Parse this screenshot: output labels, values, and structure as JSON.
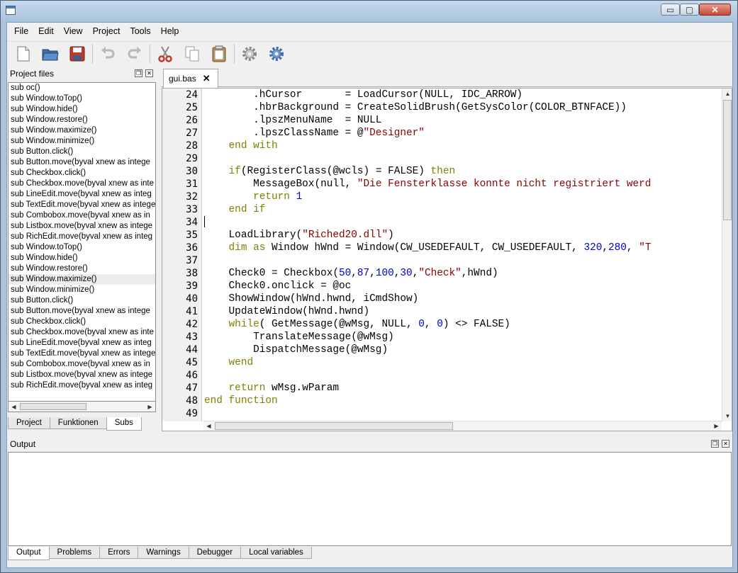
{
  "menu": [
    "File",
    "Edit",
    "View",
    "Project",
    "Tools",
    "Help"
  ],
  "toolbar": [
    {
      "name": "new-file-icon"
    },
    {
      "name": "open-folder-icon"
    },
    {
      "name": "save-icon"
    },
    {
      "name": "undo-icon"
    },
    {
      "name": "redo-icon"
    },
    {
      "name": "cut-icon"
    },
    {
      "name": "copy-icon"
    },
    {
      "name": "paste-icon"
    },
    {
      "name": "build-settings-icon"
    },
    {
      "name": "run-icon"
    }
  ],
  "window_buttons": {
    "minimize": "▭",
    "maximize": "▢",
    "close": "✕"
  },
  "left_panel": {
    "title": "Project files",
    "items": [
      "sub oc()",
      "sub Window.toTop()",
      "sub Window.hide()",
      "sub Window.restore()",
      "sub Window.maximize()",
      "sub Window.minimize()",
      "sub Button.click()",
      "sub Button.move(byval xnew as intege",
      "sub Checkbox.click()",
      "sub Checkbox.move(byval xnew as inte",
      "sub LineEdit.move(byval xnew as integ",
      "sub TextEdit.move(byval xnew as intege",
      "sub Combobox.move(byval xnew as in",
      "sub Listbox.move(byval xnew as intege",
      "sub RichEdit.move(byval xnew as integ",
      "sub Window.toTop()",
      "sub Window.hide()",
      "sub Window.restore()",
      "sub Window.maximize()",
      "sub Window.minimize()",
      "sub Button.click()",
      "sub Button.move(byval xnew as intege",
      "sub Checkbox.click()",
      "sub Checkbox.move(byval xnew as inte",
      "sub LineEdit.move(byval xnew as integ",
      "sub TextEdit.move(byval xnew as intege",
      "sub Combobox.move(byval xnew as in",
      "sub Listbox.move(byval xnew as intege",
      "sub RichEdit.move(byval xnew as integ"
    ],
    "selected_index": 18,
    "tabs": [
      "Project",
      "Funktionen",
      "Subs"
    ],
    "active_tab": 2
  },
  "editor": {
    "tab_label": "gui.bas",
    "lines": [
      {
        "n": "24",
        "segs": [
          [
            "        .hCursor       = LoadCursor(NULL, IDC_ARROW)",
            ""
          ]
        ]
      },
      {
        "n": "25",
        "segs": [
          [
            "        .hbrBackground = CreateSolidBrush(GetSysColor(COLOR_BTNFACE))",
            ""
          ]
        ]
      },
      {
        "n": "26",
        "segs": [
          [
            "        .lpszMenuName  = NULL",
            ""
          ]
        ]
      },
      {
        "n": "27",
        "segs": [
          [
            "        .lpszClassName = @",
            ""
          ],
          [
            "\"Designer\"",
            "str"
          ]
        ]
      },
      {
        "n": "28",
        "segs": [
          [
            "    ",
            ""
          ],
          [
            "end with",
            "kw"
          ]
        ]
      },
      {
        "n": "29",
        "segs": [
          [
            "",
            ""
          ]
        ]
      },
      {
        "n": "30",
        "segs": [
          [
            "    ",
            ""
          ],
          [
            "if",
            "kw"
          ],
          [
            "(RegisterClass(@wcls) = FALSE) ",
            ""
          ],
          [
            "then",
            "kw"
          ]
        ]
      },
      {
        "n": "31",
        "segs": [
          [
            "        MessageBox(null, ",
            ""
          ],
          [
            "\"Die Fensterklasse konnte nicht registriert werd",
            "str"
          ]
        ]
      },
      {
        "n": "32",
        "segs": [
          [
            "        ",
            ""
          ],
          [
            "return",
            "kw"
          ],
          [
            " ",
            ""
          ],
          [
            "1",
            "num"
          ]
        ]
      },
      {
        "n": "33",
        "segs": [
          [
            "    ",
            ""
          ],
          [
            "end if",
            "kw"
          ]
        ]
      },
      {
        "n": "34",
        "segs": [
          [
            "",
            ""
          ]
        ]
      },
      {
        "n": "35",
        "segs": [
          [
            "    LoadLibrary(",
            ""
          ],
          [
            "\"Riched20.dll\"",
            "str"
          ],
          [
            ")",
            ""
          ]
        ]
      },
      {
        "n": "36",
        "segs": [
          [
            "    ",
            ""
          ],
          [
            "dim as",
            "kw"
          ],
          [
            " Window hWnd = Window(CW_USEDEFAULT, CW_USEDEFAULT, ",
            ""
          ],
          [
            "320",
            "num"
          ],
          [
            ",",
            ""
          ],
          [
            "280",
            "num"
          ],
          [
            ", ",
            ""
          ],
          [
            "\"T",
            "str"
          ]
        ]
      },
      {
        "n": "37",
        "segs": [
          [
            "",
            ""
          ]
        ]
      },
      {
        "n": "38",
        "segs": [
          [
            "    Check0 = Checkbox(",
            ""
          ],
          [
            "50",
            "num"
          ],
          [
            ",",
            ""
          ],
          [
            "87",
            "num"
          ],
          [
            ",",
            ""
          ],
          [
            "100",
            "num"
          ],
          [
            ",",
            ""
          ],
          [
            "30",
            "num"
          ],
          [
            ",",
            ""
          ],
          [
            "\"Check\"",
            "str"
          ],
          [
            ",hWnd)",
            ""
          ]
        ]
      },
      {
        "n": "39",
        "segs": [
          [
            "    Check0.onclick = @oc",
            ""
          ]
        ]
      },
      {
        "n": "40",
        "segs": [
          [
            "    ShowWindow(hWnd.hwnd, iCmdShow)",
            ""
          ]
        ]
      },
      {
        "n": "41",
        "segs": [
          [
            "    UpdateWindow(hWnd.hwnd)",
            ""
          ]
        ]
      },
      {
        "n": "42",
        "segs": [
          [
            "    ",
            ""
          ],
          [
            "while",
            "kw"
          ],
          [
            "( GetMessage(@wMsg, NULL, ",
            ""
          ],
          [
            "0",
            "num"
          ],
          [
            ", ",
            ""
          ],
          [
            "0",
            "num"
          ],
          [
            ") <> FALSE)",
            ""
          ]
        ]
      },
      {
        "n": "43",
        "segs": [
          [
            "        TranslateMessage(@wMsg)",
            ""
          ]
        ]
      },
      {
        "n": "44",
        "segs": [
          [
            "        DispatchMessage(@wMsg)",
            ""
          ]
        ]
      },
      {
        "n": "45",
        "segs": [
          [
            "    ",
            ""
          ],
          [
            "wend",
            "kw"
          ]
        ]
      },
      {
        "n": "46",
        "segs": [
          [
            "",
            ""
          ]
        ]
      },
      {
        "n": "47",
        "segs": [
          [
            "    ",
            ""
          ],
          [
            "return",
            "kw"
          ],
          [
            " wMsg.wParam",
            ""
          ]
        ]
      },
      {
        "n": "48",
        "segs": [
          [
            "end function",
            "kw"
          ]
        ]
      },
      {
        "n": "49",
        "segs": [
          [
            "",
            ""
          ]
        ]
      }
    ]
  },
  "output_panel": {
    "title": "Output",
    "tabs": [
      "Output",
      "Problems",
      "Errors",
      "Warnings",
      "Debugger",
      "Local variables"
    ],
    "active_tab": 0
  }
}
